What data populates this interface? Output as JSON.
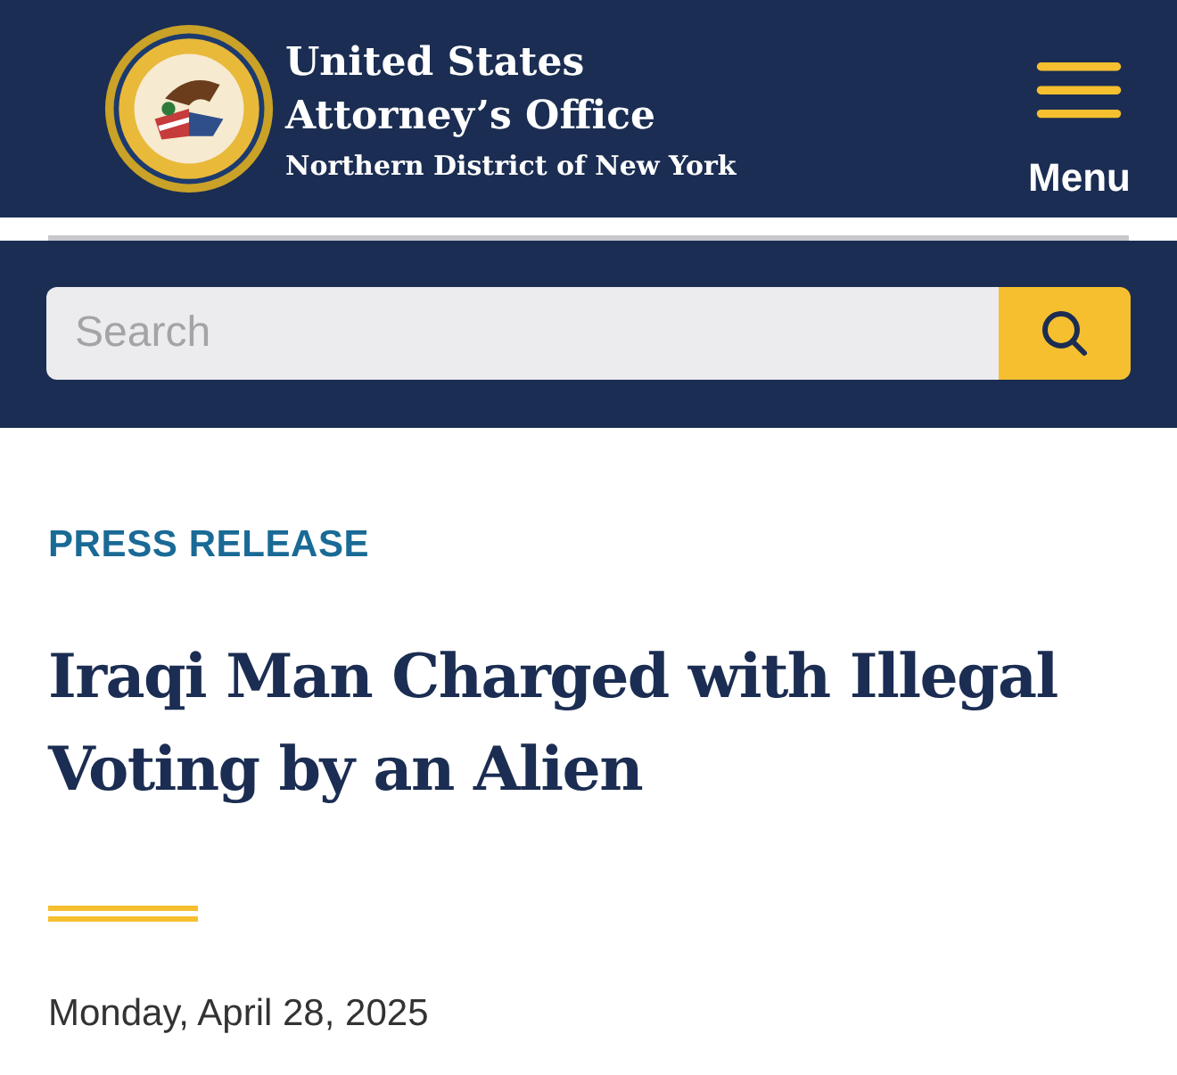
{
  "header": {
    "title_line_1": "United States",
    "title_line_2": "Attorney’s Office",
    "subtitle": "Northern District of New York",
    "menu_label": "Menu"
  },
  "search": {
    "placeholder": "Search"
  },
  "article": {
    "eyebrow": "PRESS RELEASE",
    "headline": "Iraqi Man Charged with Illegal Voting by an Alien",
    "date": "Monday, April 28, 2025"
  }
}
